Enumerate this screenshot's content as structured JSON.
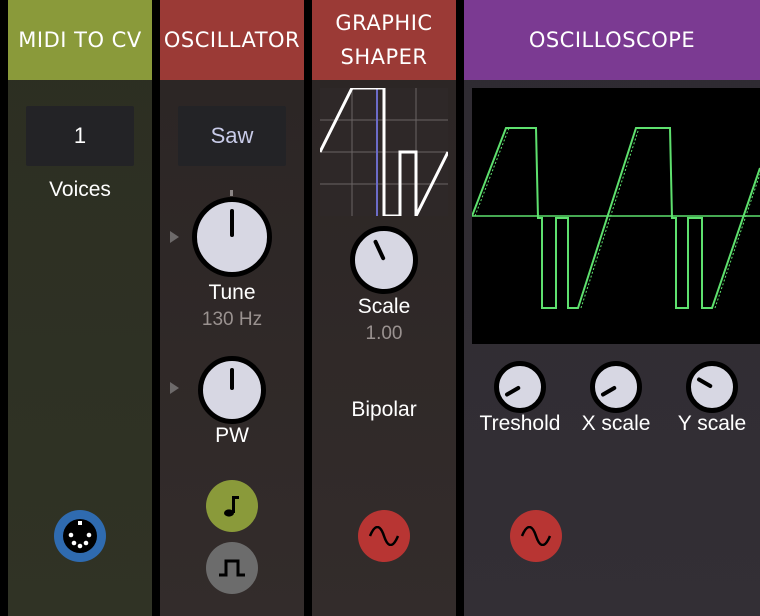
{
  "modules": {
    "midi": {
      "title": "MIDI TO CV",
      "voices_value": "1",
      "voices_label": "Voices",
      "port_icon": "midi-din-icon"
    },
    "oscillator": {
      "title": "OSCILLATOR",
      "waveform_value": "Saw",
      "tune_label": "Tune",
      "tune_value": "130 Hz",
      "pw_label": "PW",
      "note_icon": "music-note-icon",
      "pulse_icon": "square-wave-icon"
    },
    "shaper": {
      "title_line1": "GRAPHIC",
      "title_line2": "SHAPER",
      "scale_label": "Scale",
      "scale_value": "1.00",
      "mode_label": "Bipolar",
      "output_icon": "sine-wave-icon"
    },
    "scope": {
      "title": "OSCILLOSCOPE",
      "knobs": [
        {
          "label": "Treshold"
        },
        {
          "label": "X scale"
        },
        {
          "label": "Y scale"
        }
      ],
      "output_icon": "sine-wave-icon"
    }
  },
  "colors": {
    "midi_header": "#8a9a3a",
    "osc_header": "#9b3a36",
    "shaper_header": "#9b3a36",
    "scope_header": "#7b3a92",
    "trace": "#5ee06e",
    "red_port": "#b83533",
    "blue_port": "#2f6bb0",
    "green_port": "#8a9a3a",
    "grey_port": "#6c6c6c"
  }
}
